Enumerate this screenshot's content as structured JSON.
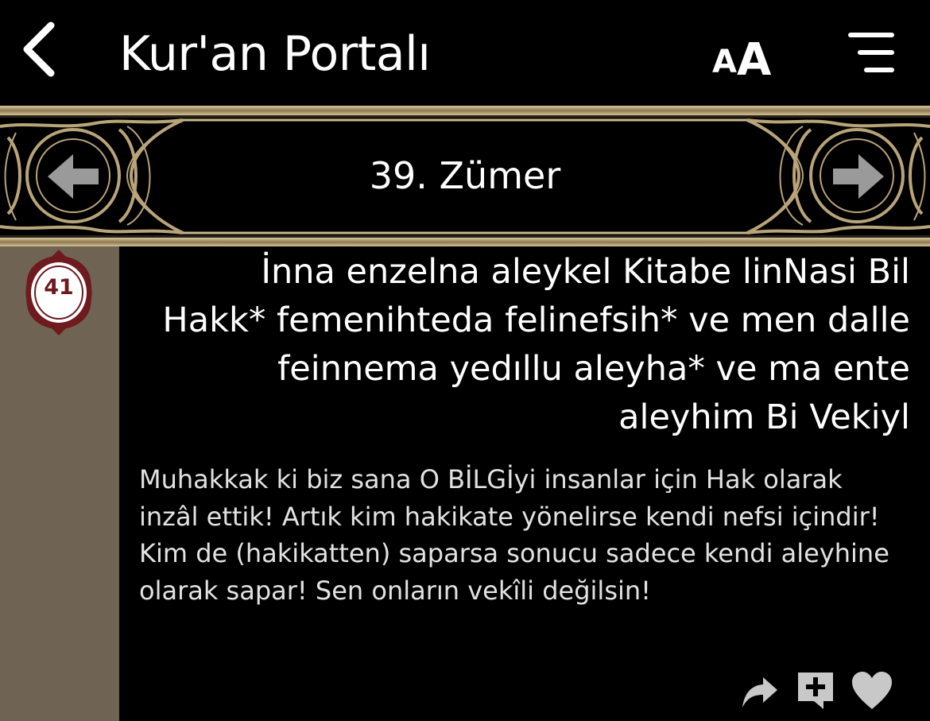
{
  "navbar": {
    "back_icon": "chevron-left-icon",
    "title": "Kur'an Portalı",
    "font_size_small": "A",
    "font_size_large": "A",
    "menu_icon": "hamburger-menu-icon"
  },
  "surah_bar": {
    "title": "39. Zümer",
    "prev_icon": "arrow-left-icon",
    "next_icon": "arrow-right-icon"
  },
  "verse": {
    "number": "41",
    "transliteration": "İnna enzelna aleykel Kitabe linNasi Bil Hakk* femenihteda felinefsih* ve men dalle feinnema yedıllu aleyha* ve ma ente aleyhim Bi Vekiyl",
    "translation": "Muhakkak ki biz sana O BİLGİyi insanlar için Hak olarak inzâl ettik! Artık kim hakikate yönelirse kendi nefsi içindir! Kim de (hakikatten) saparsa sonucu sadece kendi aleyhine olarak sapar! Sen onların vekîli değilsin!"
  },
  "actions": {
    "share_icon": "share-icon",
    "add_note_icon": "add-note-icon",
    "favorite_icon": "heart-icon"
  },
  "colors": {
    "background": "#000000",
    "gutter": "#6f6453",
    "ornament_gold": "#b9a47a",
    "badge_red": "#6e1a1e",
    "icon_gray": "#c8c8c8"
  }
}
